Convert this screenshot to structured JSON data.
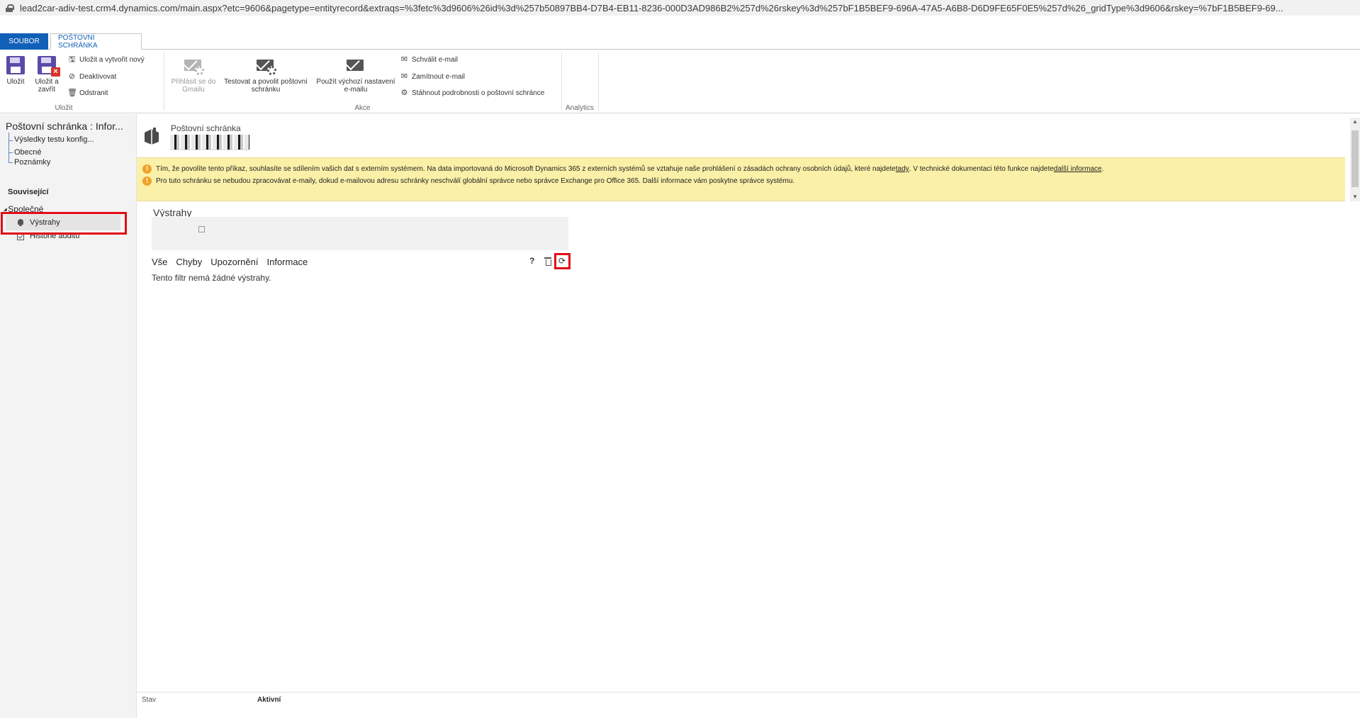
{
  "browser": {
    "url": "lead2car-adiv-test.crm4.dynamics.com/main.aspx?etc=9606&pagetype=entityrecord&extraqs=%3fetc%3d9606%26id%3d%257b50897BB4-D7B4-EB11-8236-000D3AD986B2%257d%26rskey%3d%257bF1B5BEF9-696A-47A5-A6B8-D6D9FE65F0E5%257d%26_gridType%3d9606&rskey=%7bF1B5BEF9-69..."
  },
  "tabs": {
    "file": "SOUBOR",
    "mailbox": "POŠTOVNÍ SCHRÁNKA"
  },
  "ribbon": {
    "save": {
      "save": "Uložit",
      "save_close_line1": "Uložit a",
      "save_close_line2": "zavřít",
      "save_new": "Uložit a vytvořit nový",
      "deactivate": "Deaktivovat",
      "delete": "Odstranit",
      "group_label": "Uložit"
    },
    "actions": {
      "gmail_line1": "Přihlásit se do",
      "gmail_line2": "Gmailu",
      "test_line1": "Testovat a povolit poštovní",
      "test_line2": "schránku",
      "default_line1": "Použít výchozí nastavení",
      "default_line2": "e-mailu",
      "approve": "Schválit e-mail",
      "reject": "Zamítnout e-mail",
      "download": "Stáhnout podrobnosti o poštovní schránce",
      "group_label": "Akce"
    },
    "analytics": {
      "group_label": "Analytics"
    }
  },
  "left_nav": {
    "title": "Poštovní schránka : Infor...",
    "items": [
      "Výsledky testu konfig...",
      "Obecné",
      "Poznámky"
    ],
    "related": "Související",
    "common": "Společné",
    "alerts": "Výstrahy",
    "audit": "Historie auditu"
  },
  "record": {
    "entity": "Poštovní schránka"
  },
  "notifications": {
    "line1_a": "Tím, že povolíte tento příkaz, souhlasíte se sdílením vašich dat s externím systémem. Na data importovaná do Microsoft Dynamics 365 z externích systémů se vztahuje naše prohlášení o zásadách ochrany osobních údajů, které najdete ",
    "line1_link1": "tady",
    "line1_b": ". V technické dokumentaci této funkce najdete ",
    "line1_link2": "další informace",
    "line1_c": ".",
    "line2": "Pro tuto schránku se nebudou zpracovávat e-maily, dokud e-mailovou adresu schránky neschválí globální správce nebo správce Exchange pro Office 365. Další informace vám poskytne správce systému."
  },
  "alerts": {
    "title": "Výstrahy",
    "filters": [
      "Vše",
      "Chyby",
      "Upozornění",
      "Informace"
    ],
    "help": "?",
    "empty": "Tento filtr nemá žádné výstrahy."
  },
  "footer": {
    "label": "Stav",
    "value": "Aktivní"
  }
}
